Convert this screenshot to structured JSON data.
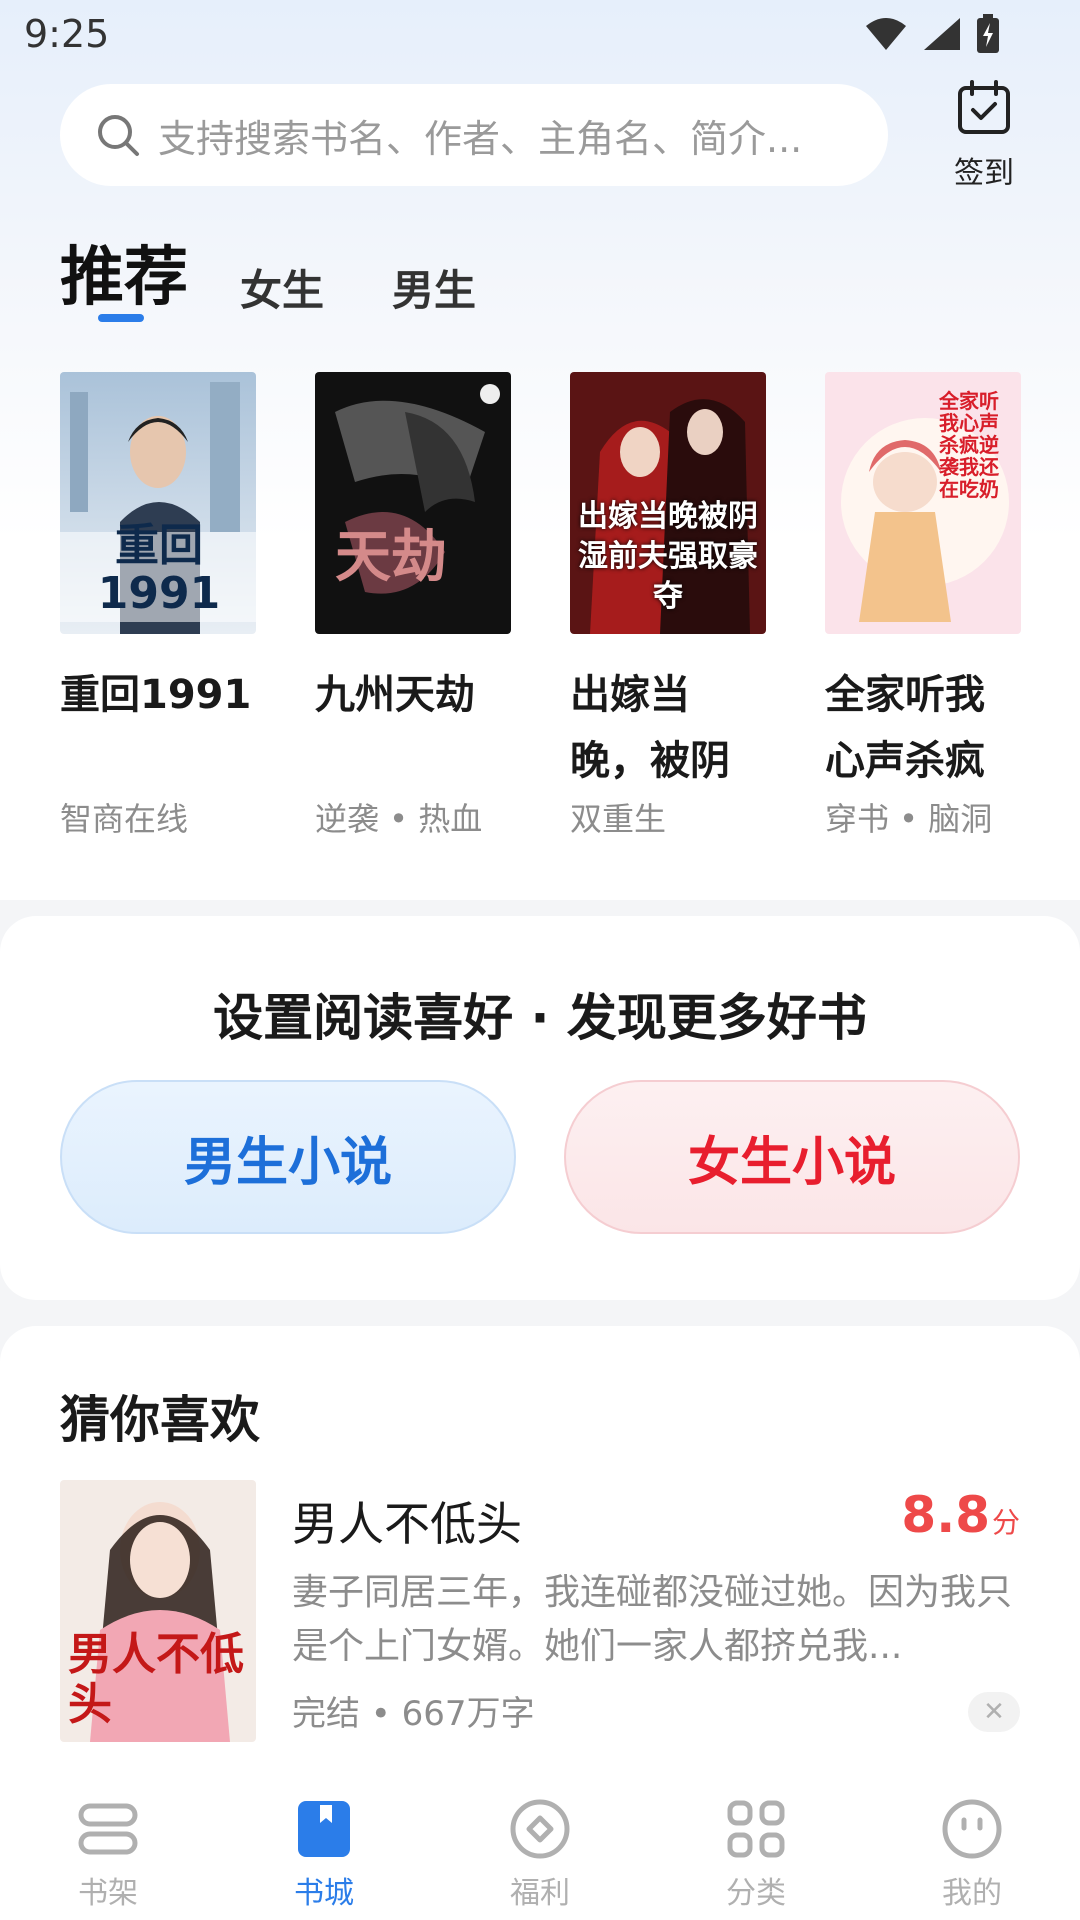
{
  "status_bar": {
    "time": "9:25"
  },
  "search": {
    "placeholder": "支持搜索书名、作者、主角名、简介..."
  },
  "checkin": {
    "label": "签到"
  },
  "tabs": [
    {
      "label": "推荐",
      "active": true
    },
    {
      "label": "女生",
      "active": false
    },
    {
      "label": "男生",
      "active": false
    }
  ],
  "recommend": {
    "books": [
      {
        "title": "重回1991",
        "tag": "智商在线",
        "cover_text": "重回1991"
      },
      {
        "title": "九州天劫",
        "tag": "逆袭 • 热血",
        "cover_text": "天劫"
      },
      {
        "title": "出嫁当晚，被阴",
        "tag": "双重生",
        "cover_text": "出嫁当晚被阴湿前夫强取豪夺"
      },
      {
        "title": "全家听我心声杀疯",
        "tag": "穿书 • 脑洞",
        "cover_text": "全家听我心声杀疯逆袭我还在吃奶"
      }
    ]
  },
  "preference": {
    "title": "设置阅读喜好 · 发现更多好书",
    "male_label": "男生小说",
    "female_label": "女生小说"
  },
  "guess": {
    "title": "猜你喜欢",
    "item": {
      "title": "男人不低头",
      "score": "8.8",
      "score_unit": "分",
      "description": "妻子同居三年，我连碰都没碰过她。因为我只是个上门女婿。她们一家人都挤兑我...",
      "meta": "完结 • 667万字",
      "cover_text": "男人不低头"
    }
  },
  "bottom_nav": [
    {
      "label": "书架",
      "icon": "bookshelf-icon",
      "active": false
    },
    {
      "label": "书城",
      "icon": "bookstore-icon",
      "active": true
    },
    {
      "label": "福利",
      "icon": "welfare-icon",
      "active": false
    },
    {
      "label": "分类",
      "icon": "category-icon",
      "active": false
    },
    {
      "label": "我的",
      "icon": "profile-icon",
      "active": false
    }
  ],
  "colors": {
    "accent_blue": "#2b7de9",
    "accent_red": "#e81e2e",
    "score_red": "#ee4949"
  }
}
